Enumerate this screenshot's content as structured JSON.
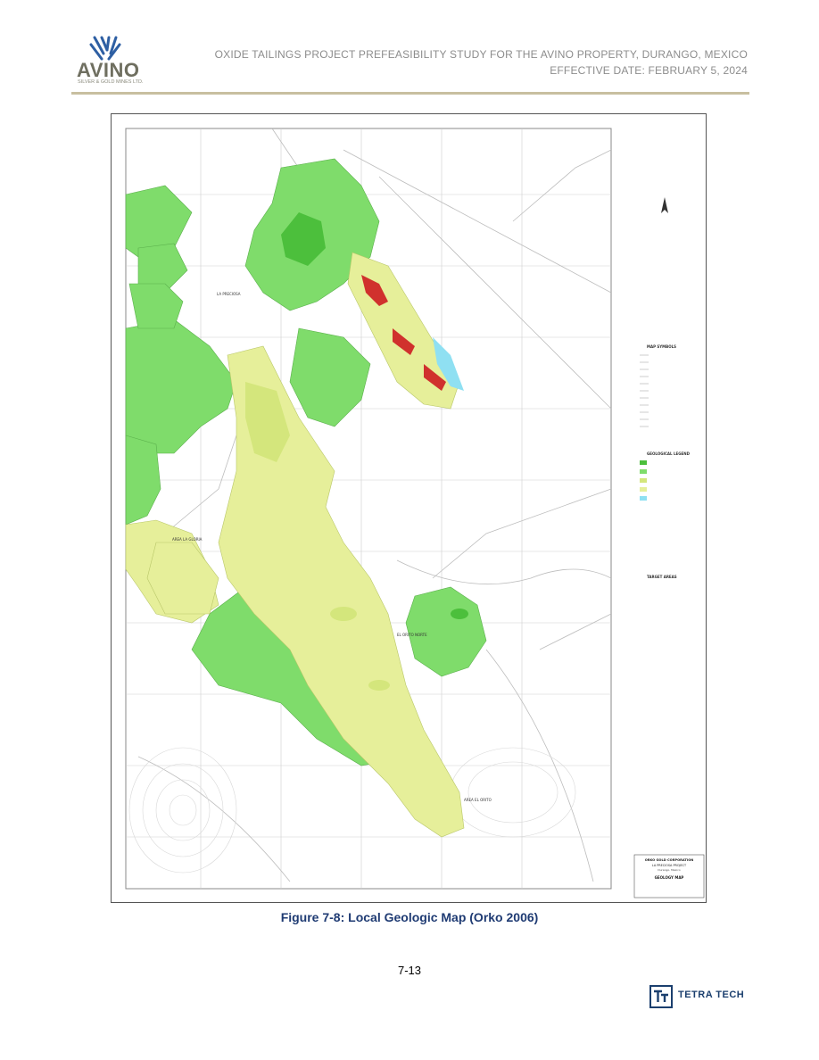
{
  "header": {
    "logo_text": "AVINO",
    "logo_subtext": "SILVER & GOLD MINES LTD.",
    "title_line1": "OXIDE TAILINGS PROJECT PREFEASIBILITY STUDY FOR THE AVINO PROPERTY, DURANGO, MEXICO",
    "title_line2": "EFFECTIVE DATE: FEBRUARY 5, 2024"
  },
  "map": {
    "legend_map_symbols": "MAP SYMBOLS",
    "legend_geological": "GEOLOGICAL LEGEND",
    "legend_target_areas": "TARGET AREAS",
    "title_block": {
      "company": "ORKO GOLD CORPORATION",
      "project": "LA PRECIOSA PROJECT",
      "location": "Durango, Mexico",
      "map_title": "GEOLOGY MAP"
    },
    "labels": {
      "la_preciosa": "LA PRECIOSA",
      "la_gloria": "AREA LA GLORIA",
      "el_orito": "EL ORITO NORTE",
      "el_orito_sur": "AREA EL ORITO"
    },
    "colors": {
      "green": "#7fdc6b",
      "dark_green": "#4cbf3c",
      "yellow": "#e6ef9a",
      "yellow_mid": "#d4e67c",
      "red": "#d0312d",
      "cyan": "#8fe0f2",
      "lines": "#bdbdbd"
    }
  },
  "caption": "Figure 7-8: Local Geologic Map (Orko 2006)",
  "page_number": "7-13",
  "footer": {
    "brand": "TETRA TECH",
    "icon": "tetra-tech-logo-icon"
  }
}
